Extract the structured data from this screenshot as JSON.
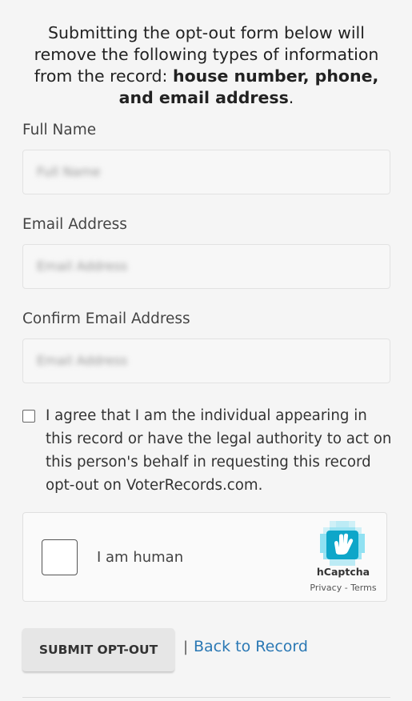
{
  "intro": {
    "text_prefix": "Submitting the opt-out form below will remove the following types of information from the record: ",
    "bold_text": "house number, phone, and email address",
    "suffix": "."
  },
  "form": {
    "full_name": {
      "label": "Full Name",
      "placeholder": "Full Name"
    },
    "email": {
      "label": "Email Address",
      "placeholder": "Email Address"
    },
    "confirm_email": {
      "label": "Confirm Email Address",
      "placeholder": "Email Address"
    },
    "consent": {
      "checked": false,
      "text": "I agree that I am the individual appearing in this record or have the legal authority to act on this person's behalf in requesting this record opt-out on VoterRecords.com."
    },
    "captcha": {
      "label": "I am human",
      "brand": "hCaptcha",
      "privacy": "Privacy",
      "terms": "Terms",
      "logo_icon": "hcaptcha-hand-logo"
    },
    "submit_label": "SUBMIT OPT-OUT",
    "separator": "|",
    "back_link": "Back to Record"
  },
  "colors": {
    "link": "#2a78b4",
    "background": "#f5f5f5",
    "button": "#e6e6e6",
    "captcha_logo_light": "#7ddcf0",
    "captcha_logo_dark": "#0ea6c9"
  }
}
